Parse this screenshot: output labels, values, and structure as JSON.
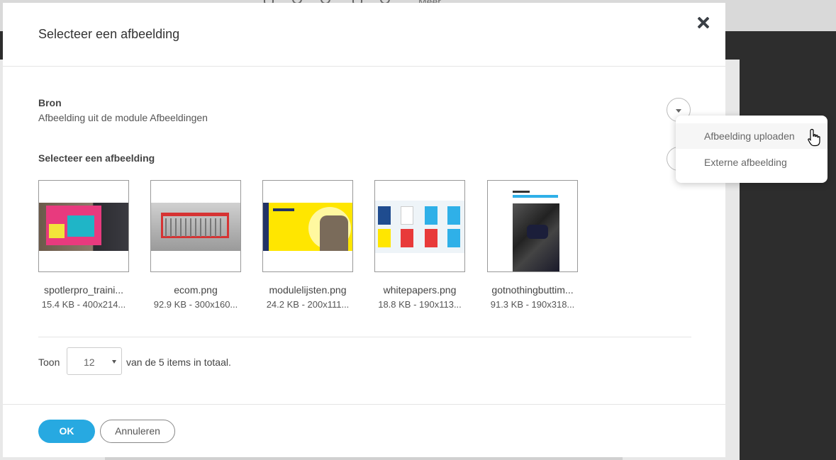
{
  "background": {
    "toolbar_more": "Meer"
  },
  "modal": {
    "title": "Selecteer een afbeelding",
    "close_icon": "close-icon",
    "source": {
      "label": "Bron",
      "value": "Afbeelding uit de module Afbeeldingen"
    },
    "select_label": "Selecteer een afbeelding",
    "images": [
      {
        "name": "spotlerpro_traini...",
        "meta": "15.4 KB - 400x214..."
      },
      {
        "name": "ecom.png",
        "meta": "92.9 KB - 300x160..."
      },
      {
        "name": "modulelijsten.png",
        "meta": "24.2 KB - 200x111..."
      },
      {
        "name": "whitepapers.png",
        "meta": "18.8 KB - 190x113..."
      },
      {
        "name": "gotnothingbuttim...",
        "meta": "91.3 KB - 190x318..."
      }
    ],
    "pager": {
      "show_label": "Toon",
      "page_size": "12",
      "total_text": "van de 5 items in totaal."
    },
    "footer": {
      "ok_label": "OK",
      "cancel_label": "Annuleren"
    }
  },
  "dropdown_menu": {
    "items": [
      {
        "label": "Afbeelding uploaden"
      },
      {
        "label": "Externe afbeelding"
      }
    ]
  },
  "colors": {
    "primary": "#27a9e1",
    "text": "#444444"
  }
}
